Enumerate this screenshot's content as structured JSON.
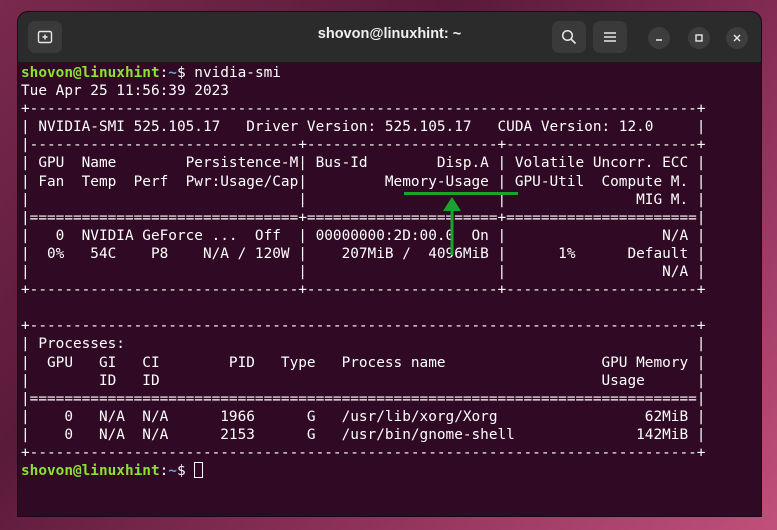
{
  "window": {
    "title": "shovon@linuxhint: ~"
  },
  "icons": {
    "new_tab": "new-tab-icon",
    "search": "search-icon",
    "menu": "hamburger-menu-icon",
    "minimize": "minimize-icon",
    "maximize": "maximize-icon",
    "close": "close-icon"
  },
  "colors": {
    "terminal_bg": "#300a24",
    "prompt_user": "#8ae234",
    "prompt_path": "#729fcf",
    "annotation": "#1aa32c"
  },
  "terminal": {
    "prompt_user": "shovon@linuxhint",
    "prompt_sep": ":",
    "prompt_path": "~",
    "prompt_end": "$ ",
    "command": "nvidia-smi",
    "output": [
      "Tue Apr 25 11:56:39 2023",
      "+-----------------------------------------------------------------------------+",
      "| NVIDIA-SMI 525.105.17   Driver Version: 525.105.17   CUDA Version: 12.0     |",
      "|-------------------------------+----------------------+----------------------+",
      "| GPU  Name        Persistence-M| Bus-Id        Disp.A | Volatile Uncorr. ECC |",
      "| Fan  Temp  Perf  Pwr:Usage/Cap|         Memory-Usage | GPU-Util  Compute M. |",
      "|                               |                      |               MIG M. |",
      "|===============================+======================+======================|",
      "|   0  NVIDIA GeForce ...  Off  | 00000000:2D:00.0  On |                  N/A |",
      "|  0%   54C    P8    N/A / 120W |    207MiB /  4096MiB |      1%      Default |",
      "|                               |                      |                  N/A |",
      "+-------------------------------+----------------------+----------------------+",
      "",
      "+-----------------------------------------------------------------------------+",
      "| Processes:                                                                  |",
      "|  GPU   GI   CI        PID   Type   Process name                  GPU Memory |",
      "|        ID   ID                                                   Usage      |",
      "|=============================================================================|",
      "|    0   N/A  N/A      1966      G   /usr/lib/xorg/Xorg                 62MiB |",
      "|    0   N/A  N/A      2153      G   /usr/bin/gnome-shell              142MiB |",
      "+-----------------------------------------------------------------------------+"
    ]
  }
}
